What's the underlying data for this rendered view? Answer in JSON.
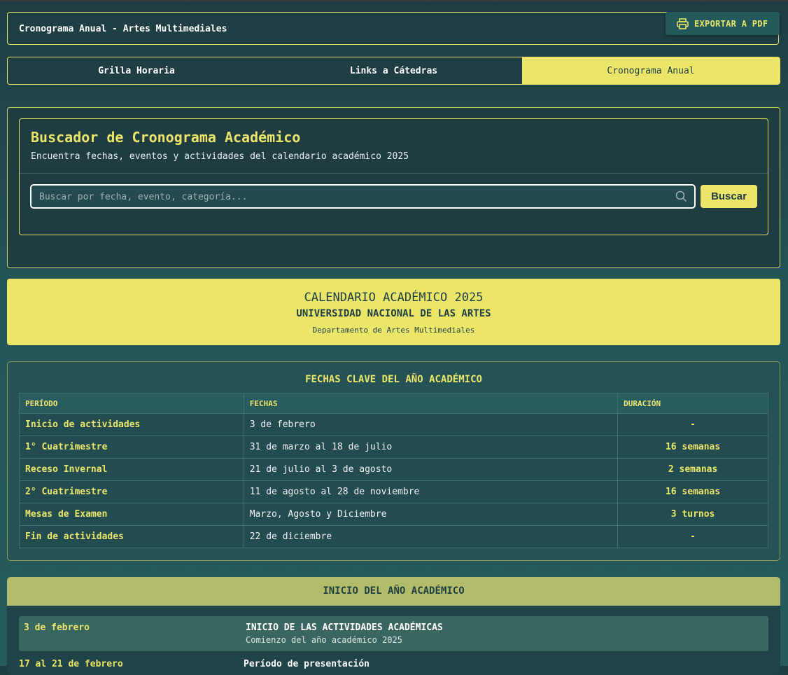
{
  "header": {
    "title": "Cronograma Anual - Artes Multimediales",
    "export_label": "EXPORTAR A PDF"
  },
  "tabs": [
    {
      "label": "Grilla Horaria",
      "active": false
    },
    {
      "label": "Links a Cátedras",
      "active": false
    },
    {
      "label": "Cronograma Anual",
      "active": true
    }
  ],
  "search": {
    "heading": "Buscador de Cronograma Académico",
    "subtitle": "Encuentra fechas, eventos y actividades del calendario académico 2025",
    "placeholder": "Buscar por fecha, evento, categoría...",
    "value": "",
    "button_label": "Buscar"
  },
  "banner": {
    "title": "CALENDARIO ACADÉMICO 2025",
    "university": "UNIVERSIDAD NACIONAL DE LAS ARTES",
    "department": "Departamento de Artes Multimediales"
  },
  "key_dates": {
    "heading": "FECHAS CLAVE DEL AÑO ACADÉMICO",
    "columns": [
      "PERÍODO",
      "FECHAS",
      "DURACIÓN"
    ],
    "rows": [
      {
        "period": "Inicio de actividades",
        "dates": "3 de febrero",
        "duration": "-"
      },
      {
        "period": "1° Cuatrimestre",
        "dates": "31 de marzo al 18 de julio",
        "duration": "16 semanas"
      },
      {
        "period": "Receso Invernal",
        "dates": "21 de julio al 3 de agosto",
        "duration": "2 semanas"
      },
      {
        "period": "2° Cuatrimestre",
        "dates": "11 de agosto al 28 de noviembre",
        "duration": "16 semanas"
      },
      {
        "period": "Mesas de Examen",
        "dates": "Marzo, Agosto y Diciembre",
        "duration": "3 turnos"
      },
      {
        "period": "Fin de actividades",
        "dates": "22 de diciembre",
        "duration": "-"
      }
    ]
  },
  "start_section": {
    "heading": "INICIO DEL AÑO ACADÉMICO",
    "events": [
      {
        "date": "3 de febrero",
        "title": "INICIO DE LAS ACTIVIDADES ACADÉMICAS",
        "subtitle": "Comienzo del año académico 2025"
      },
      {
        "date": "17 al 21 de febrero",
        "title": "Período de presentación",
        "subtitle": ""
      }
    ]
  },
  "colors": {
    "accent": "#ebe66a",
    "panel": "#1f3e43",
    "background": "#245559"
  }
}
